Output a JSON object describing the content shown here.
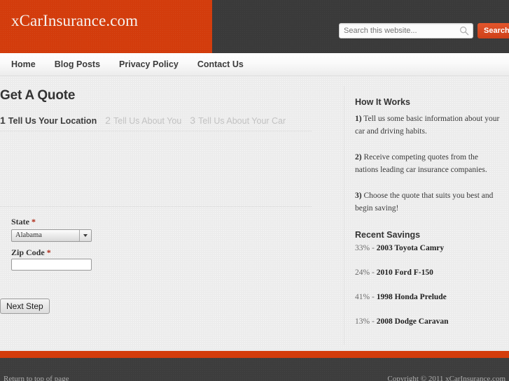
{
  "header": {
    "site_title": "xCarInsurance.com",
    "orange_color": "#d33c0c",
    "dark_color": "#3a3a3a",
    "search": {
      "placeholder": "Search this website...",
      "value": "",
      "icon": "search-icon",
      "button_label": "Search",
      "button_color": "#d6502a"
    }
  },
  "nav": {
    "items": [
      {
        "label": "Home"
      },
      {
        "label": "Blog Posts"
      },
      {
        "label": "Privacy Policy"
      },
      {
        "label": "Contact Us"
      }
    ]
  },
  "main": {
    "page_title": "Get A Quote",
    "steps": [
      {
        "num": "1",
        "label": "Tell Us Your Location",
        "state": "active"
      },
      {
        "num": "2",
        "label": "Tell Us About You",
        "state": "inactive"
      },
      {
        "num": "3",
        "label": "Tell Us About Your Car",
        "state": "inactive"
      }
    ],
    "form": {
      "state_label": "State",
      "state_required": "*",
      "state_value": "Alabama",
      "state_arrow_icon": "chevron-down-icon",
      "zip_label": "Zip Code",
      "zip_required": "*",
      "zip_value": "",
      "zip_placeholder": ""
    },
    "next_step_label": "Next Step"
  },
  "sidebar": {
    "how_it_works": {
      "title": "How It Works",
      "items": [
        {
          "num": "1)",
          "text": " Tell us some basic information about your car and driving habits."
        },
        {
          "num": "2)",
          "text": " Receive competing quotes from the nations leading car insurance companies."
        },
        {
          "num": "3)",
          "text": " Choose the quote that suits you best and begin saving!"
        }
      ]
    },
    "recent_savings": {
      "title": "Recent Savings",
      "items": [
        {
          "pct": "33%",
          "dash": " - ",
          "car": "2003 Toyota Camry"
        },
        {
          "pct": "24%",
          "dash": " - ",
          "car": "2010 Ford F-150"
        },
        {
          "pct": "41%",
          "dash": " - ",
          "car": "1998 Honda Prelude"
        },
        {
          "pct": "13%",
          "dash": " - ",
          "car": "2008 Dodge Caravan"
        }
      ]
    }
  },
  "footer": {
    "return_to_top": "Return to top of page",
    "copyright": "Copyright © 2011 xCarInsurance.com",
    "bar_color": "#d33c0c"
  }
}
